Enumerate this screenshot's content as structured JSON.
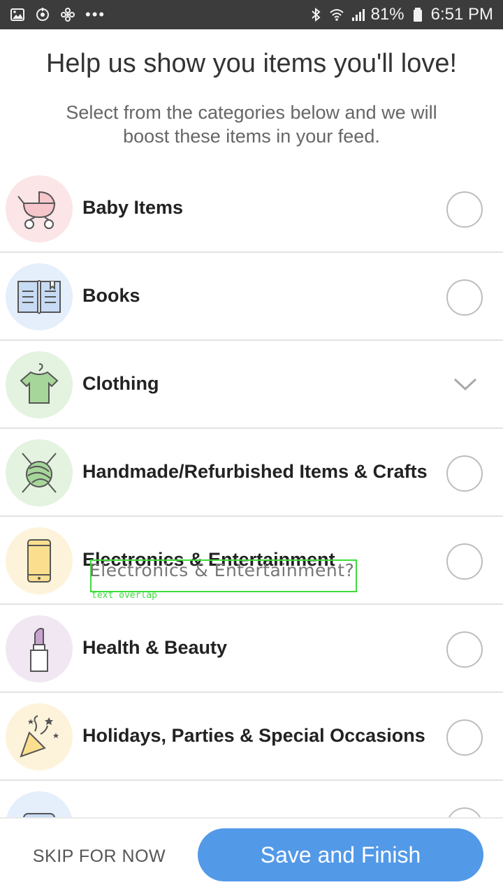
{
  "status_bar": {
    "battery": "81%",
    "time": "6:51 PM",
    "more": "•••",
    "left_icons": [
      "gallery-icon",
      "sync-icon",
      "fan-icon"
    ],
    "right_icons": [
      "bluetooth-icon",
      "wifi-icon",
      "signal-icon",
      "battery-icon"
    ]
  },
  "header": {
    "title": "Help us show you items you'll love!",
    "subtitle": "Select from the categories below and we will boost these items in your feed."
  },
  "categories": [
    {
      "label": "Baby Items",
      "icon": "stroller-icon",
      "bg": "#fbe5e6",
      "control": "radio"
    },
    {
      "label": "Books",
      "icon": "book-icon",
      "bg": "#e5eefb",
      "control": "radio"
    },
    {
      "label": "Clothing",
      "icon": "shirt-icon",
      "bg": "#e4f2e0",
      "control": "chevron"
    },
    {
      "label": "Handmade/Refurbished Items & Crafts",
      "icon": "yarn-icon",
      "bg": "#e4f2e0",
      "control": "radio"
    },
    {
      "label": "Electronics & Entertainment",
      "icon": "phone-icon",
      "bg": "#fdf3da",
      "control": "radio"
    },
    {
      "label": "Health & Beauty",
      "icon": "lipstick-icon",
      "bg": "#f1e7f3",
      "control": "radio"
    },
    {
      "label": "Holidays, Parties & Special Occasions",
      "icon": "party-icon",
      "bg": "#fdf3da",
      "control": "radio"
    },
    {
      "label": "",
      "icon": "home-icon",
      "bg": "#e5eefb",
      "control": "radio"
    }
  ],
  "overlay": {
    "text": "Electronics & Entertainment?",
    "tag": "text overlap",
    "color": "#3ddc3d"
  },
  "footer": {
    "skip_label": "SKIP FOR NOW",
    "save_label": "Save and Finish",
    "save_color": "#5299e8"
  }
}
